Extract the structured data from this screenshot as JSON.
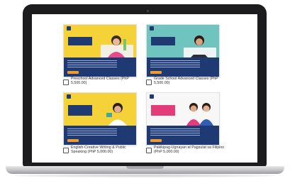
{
  "colors": {
    "navy": "#1f3a73",
    "orange": "#f29b2b",
    "yellow_bg": "#f4d238",
    "teal_bg": "#3fa7a0",
    "pink": "#e23c7a"
  },
  "products": [
    {
      "label": "Preschool Advanced Classes (PhP 5,500.00)",
      "checked": false
    },
    {
      "label": "Grade School Advanced Classes (PhP 5,500.00)",
      "checked": false
    },
    {
      "label": "English-Creative Writing & Public Speaking (PhP 5,000.00)",
      "checked": false
    },
    {
      "label": "Pakikipag-Ugnayan at Pagsulat sa Filipino (PhP 5,000.00)",
      "checked": false
    }
  ]
}
